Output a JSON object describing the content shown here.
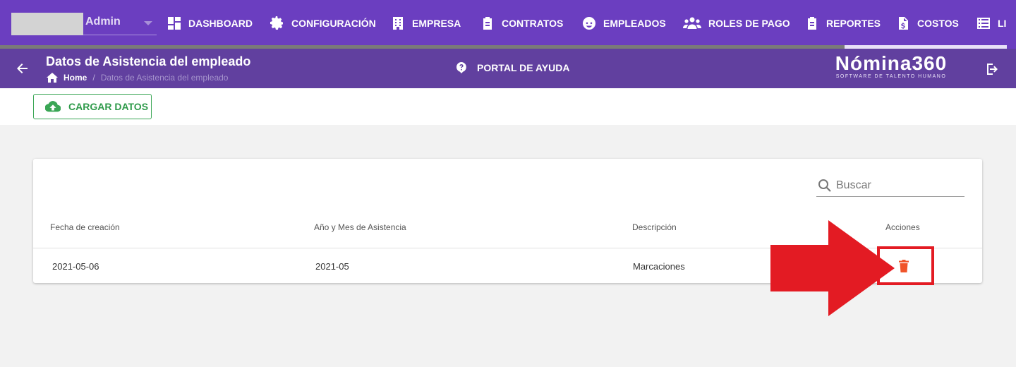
{
  "nav": {
    "user_name": "Admin",
    "items": [
      {
        "label": "DASHBOARD",
        "icon": "dashboard-icon"
      },
      {
        "label": "CONFIGURACIÓN",
        "icon": "gear-icon"
      },
      {
        "label": "EMPRESA",
        "icon": "building-icon"
      },
      {
        "label": "CONTRATOS",
        "icon": "clipboard-icon"
      },
      {
        "label": "EMPLEADOS",
        "icon": "face-icon"
      },
      {
        "label": "ROLES DE PAGO",
        "icon": "people-icon"
      },
      {
        "label": "REPORTES",
        "icon": "clipboard-icon"
      },
      {
        "label": "COSTOS",
        "icon": "dollar-file-icon"
      },
      {
        "label": "LI",
        "icon": "list-icon"
      }
    ]
  },
  "header": {
    "title": "Datos de Asistencia del empleado",
    "breadcrumb_home": "Home",
    "breadcrumb_sep": "/",
    "breadcrumb_current": "Datos de Asistencia del empleado",
    "help_label": "PORTAL DE AYUDA",
    "brand_name": "Nómina360",
    "brand_tagline": "SOFTWARE DE TALENTO HUMANO"
  },
  "toolbar": {
    "upload_label": "CARGAR DATOS"
  },
  "table": {
    "search_placeholder": "Buscar",
    "columns": [
      "Fecha de creación",
      "Año y Mes de Asistencia",
      "Descripción",
      "Acciones"
    ],
    "rows": [
      [
        "2021-05-06",
        "2021-05",
        "Marcaciones"
      ]
    ]
  },
  "colors": {
    "nav_bg": "#6b3ec0",
    "subheader_bg": "#61409f",
    "upload_green": "#3aa655",
    "delete_orange": "#f0542a",
    "annotation_red": "#e31b23"
  }
}
